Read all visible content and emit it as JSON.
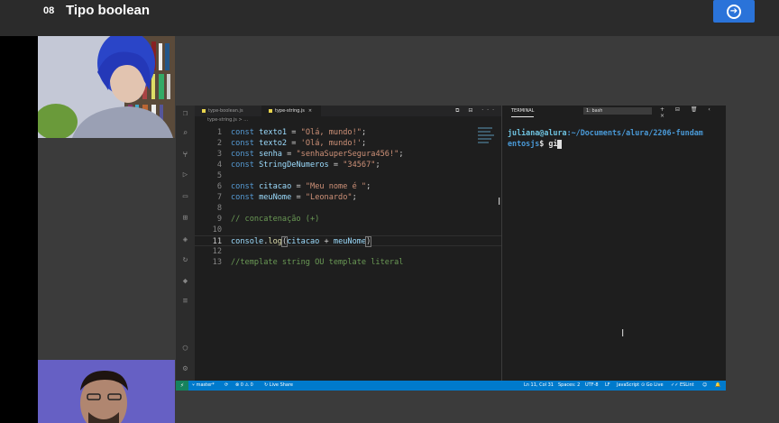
{
  "lesson": {
    "number": "08",
    "title": "Tipo boolean"
  },
  "next_button": {
    "icon": "arrow-right-circle-icon"
  },
  "colors": {
    "accent": "#2a73d9",
    "statusbar": "#007acc",
    "page_bg": "#3b3b3b"
  },
  "editor": {
    "tabs": [
      {
        "label": "type-boolean.js",
        "active": false
      },
      {
        "label": "type-string.js",
        "active": true,
        "close": "×"
      }
    ],
    "breadcrumb": "type-string.js > ...",
    "lines": [
      {
        "n": "1",
        "html": "const texto1 = \"Olá, mundo!\";"
      },
      {
        "n": "2",
        "html": "const texto2 = 'Olá, mundo!';"
      },
      {
        "n": "3",
        "html": "const senha = \"senhaSuperSegura456!\";"
      },
      {
        "n": "4",
        "html": "const StringDeNumeros = \"34567\";"
      },
      {
        "n": "5",
        "html": ""
      },
      {
        "n": "6",
        "html": "const citacao = \"Meu nome é \";"
      },
      {
        "n": "7",
        "html": "const meuNome = \"Leonardo\";"
      },
      {
        "n": "8",
        "html": ""
      },
      {
        "n": "9",
        "html": "// concatenação (+)"
      },
      {
        "n": "10",
        "html": ""
      },
      {
        "n": "11",
        "html": "console.log(citacao + meuNome)"
      },
      {
        "n": "12",
        "html": ""
      },
      {
        "n": "13",
        "html": "//template string OU template literal"
      }
    ]
  },
  "terminal": {
    "tab_label": "TERMINAL",
    "shell_select": "1: bash",
    "prompt_user": "juliana@alura",
    "prompt_path": ":~/Documents/alura/2206-fundam",
    "prompt_path2": "entosjs",
    "prompt_cmd": "$ gi"
  },
  "statusbar": {
    "branch": "master*",
    "sync": "⟳",
    "problems": "⊗ 0 ⚠ 0",
    "live_share": "Live Share",
    "position": "Ln 11, Col 31",
    "spaces": "Spaces: 2",
    "encoding": "UTF-8",
    "eol": "LF",
    "language": "JavaScript",
    "go_live": "Go Live",
    "eslint": "ESLint"
  }
}
